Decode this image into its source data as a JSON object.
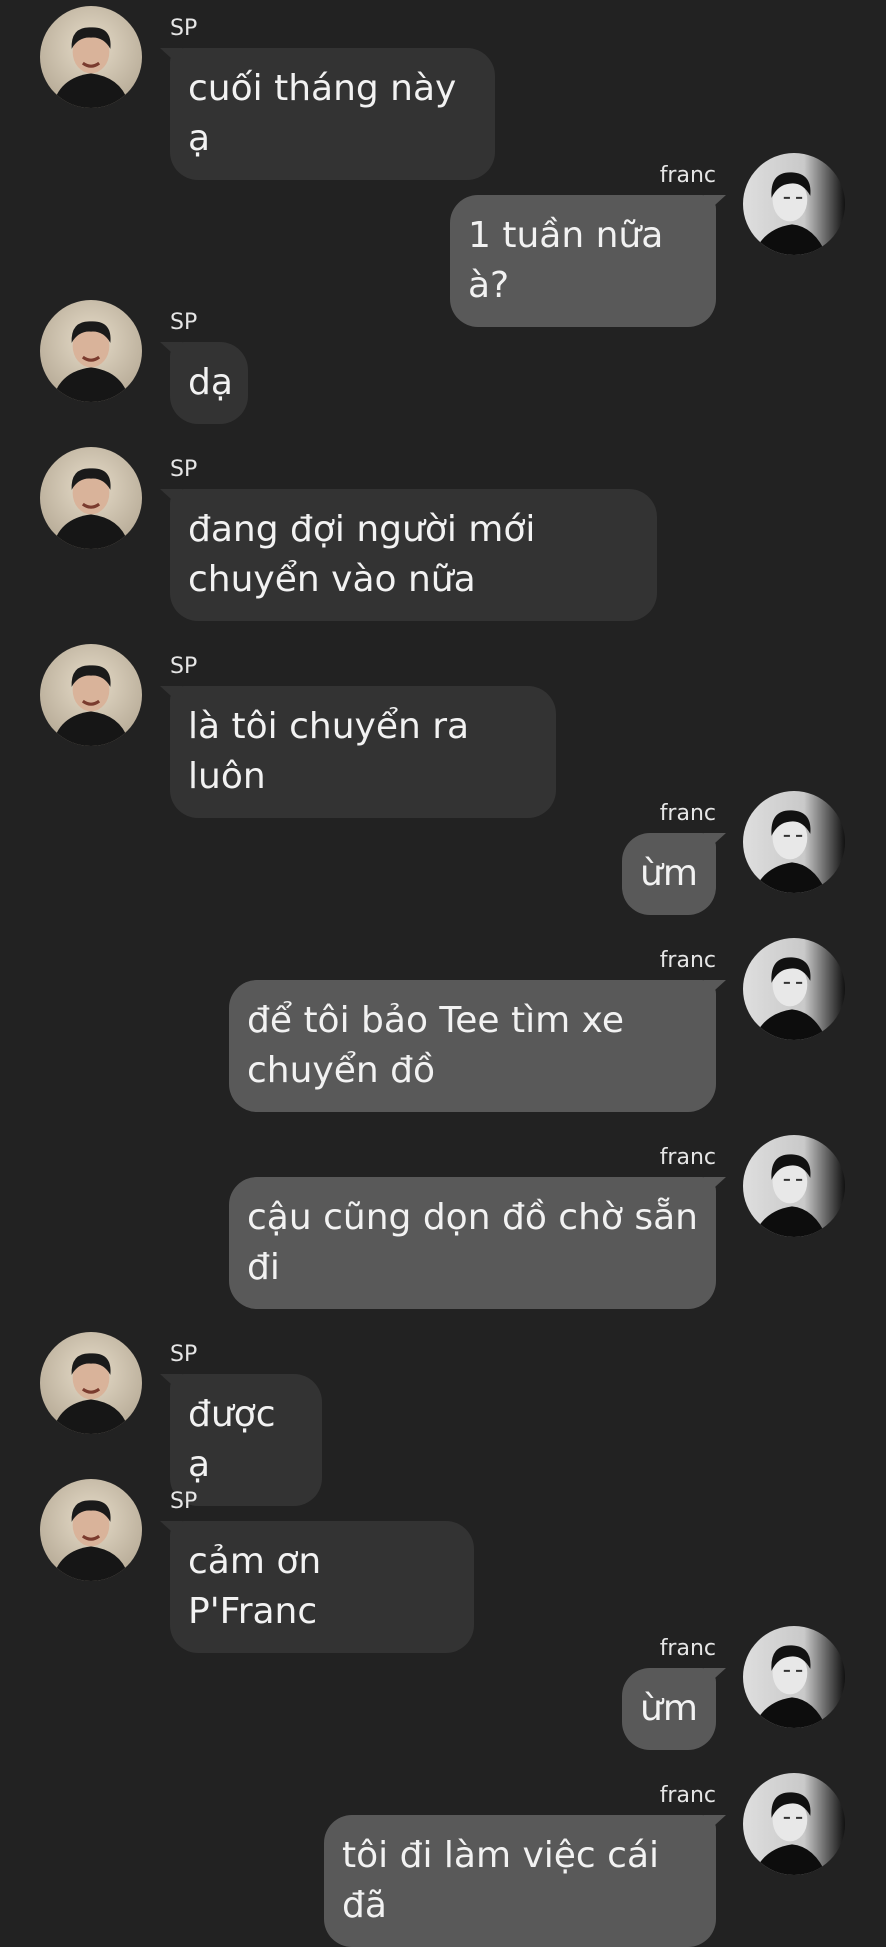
{
  "chat": {
    "contacts": {
      "in_name": "SP",
      "out_name": "franc"
    },
    "messages": [
      {
        "side": "in",
        "sender": "SP",
        "text": "cuối tháng này ạ"
      },
      {
        "side": "out",
        "sender": "franc",
        "text": "1 tuần nữa à?"
      },
      {
        "side": "in",
        "sender": "SP",
        "text": "dạ"
      },
      {
        "side": "in",
        "sender": "SP",
        "text": "đang đợi người mới chuyển vào nữa"
      },
      {
        "side": "in",
        "sender": "SP",
        "text": "là tôi chuyển ra luôn"
      },
      {
        "side": "out",
        "sender": "franc",
        "text": "ừm"
      },
      {
        "side": "out",
        "sender": "franc",
        "text": "để tôi bảo Tee tìm xe chuyển đồ"
      },
      {
        "side": "out",
        "sender": "franc",
        "text": "cậu cũng dọn đồ chờ sẵn đi"
      },
      {
        "side": "in",
        "sender": "SP",
        "text": "được ạ"
      },
      {
        "side": "in",
        "sender": "SP",
        "text": "cảm ơn P'Franc"
      },
      {
        "side": "out",
        "sender": "franc",
        "text": "ừm"
      },
      {
        "side": "out",
        "sender": "franc",
        "text": "tôi đi làm việc cái đã"
      }
    ]
  },
  "theme": {
    "background": "#222222",
    "incoming_bubble": "#333333",
    "outgoing_bubble": "#595959",
    "text": "#f2f2f2",
    "icons": {
      "in_avatar": "avatar-sp-icon",
      "out_avatar": "avatar-franc-icon"
    }
  }
}
